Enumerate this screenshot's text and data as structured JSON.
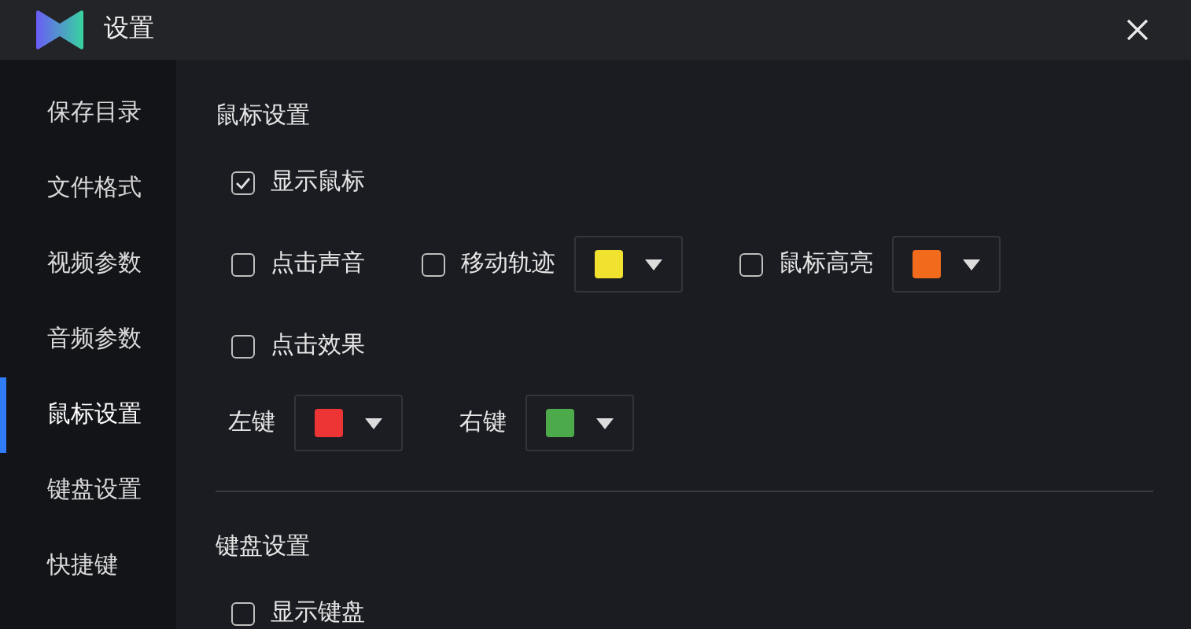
{
  "window": {
    "title": "设置"
  },
  "sidebar": {
    "items": [
      {
        "label": "保存目录",
        "selected": false
      },
      {
        "label": "文件格式",
        "selected": false
      },
      {
        "label": "视频参数",
        "selected": false
      },
      {
        "label": "音频参数",
        "selected": false
      },
      {
        "label": "鼠标设置",
        "selected": true
      },
      {
        "label": "键盘设置",
        "selected": false
      },
      {
        "label": "快捷键",
        "selected": false
      }
    ]
  },
  "sections": [
    {
      "title": "鼠标设置",
      "rows": [
        [
          {
            "kind": "checkbox",
            "label": "显示鼠标",
            "checked": true
          }
        ],
        [
          {
            "kind": "checkbox",
            "label": "点击声音",
            "checked": false
          },
          {
            "kind": "color_checkbox",
            "label": "移动轨迹",
            "checked": false,
            "color": "#f2e230"
          },
          {
            "kind": "color_checkbox",
            "label": "鼠标高亮",
            "checked": false,
            "color": "#f26b1d"
          }
        ],
        [
          {
            "kind": "checkbox",
            "label": "点击效果",
            "checked": false
          }
        ],
        [
          {
            "kind": "color_label",
            "label": "左键",
            "color": "#ee3535"
          },
          {
            "kind": "color_label",
            "label": "右键",
            "color": "#4caa4a"
          }
        ]
      ]
    },
    {
      "title": "键盘设置",
      "rows": [
        [
          {
            "kind": "checkbox",
            "label": "显示键盘",
            "checked": false
          }
        ]
      ]
    }
  ]
}
